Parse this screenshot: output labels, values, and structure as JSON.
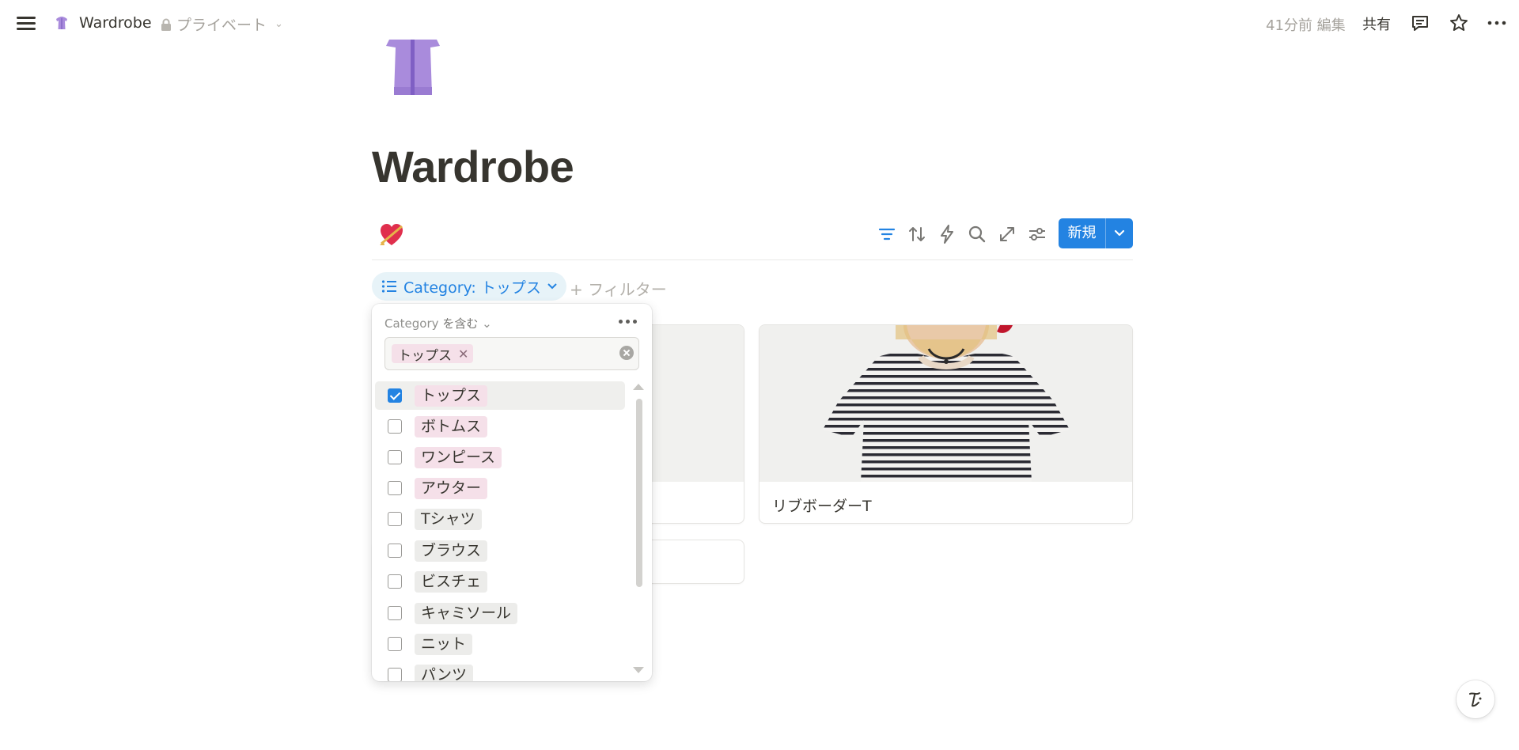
{
  "topbar": {
    "title": "Wardrobe",
    "privacy": "プライベート",
    "edited": "41分前 編集",
    "share": "共有",
    "icons": [
      "menu-icon",
      "lock-icon",
      "chevron-down-icon",
      "comment-icon",
      "star-icon",
      "more-icon"
    ]
  },
  "page": {
    "title": "Wardrobe",
    "icon": "dress-icon"
  },
  "database": {
    "view_icon": "heart-with-arrow-icon",
    "tools": [
      "filter-icon",
      "sort-icon",
      "automation-icon",
      "search-icon",
      "expand-icon",
      "settings-icon"
    ],
    "new_label": "新規",
    "filter_chip": "Category: トップス",
    "add_filter": "+ フィルター"
  },
  "cards": [
    {
      "title": "リブボーダーT"
    }
  ],
  "filter_popup": {
    "property": "Category",
    "operator": "を含む",
    "selected_tag": "トップス",
    "options": [
      {
        "label": "トップス",
        "checked": true,
        "color": "pink"
      },
      {
        "label": "ボトムス",
        "checked": false,
        "color": "pink"
      },
      {
        "label": "ワンピース",
        "checked": false,
        "color": "pink"
      },
      {
        "label": "アウター",
        "checked": false,
        "color": "pink"
      },
      {
        "label": "Tシャツ",
        "checked": false,
        "color": "gray"
      },
      {
        "label": "ブラウス",
        "checked": false,
        "color": "gray"
      },
      {
        "label": "ビスチェ",
        "checked": false,
        "color": "gray"
      },
      {
        "label": "キャミソール",
        "checked": false,
        "color": "gray"
      },
      {
        "label": "ニット",
        "checked": false,
        "color": "gray"
      },
      {
        "label": "パンツ",
        "checked": false,
        "color": "gray"
      }
    ]
  },
  "colors": {
    "accent": "#2383e2",
    "text": "#37352f",
    "pink_tag": "#f5e0e9",
    "gray_tag": "#ececea",
    "dress": "#a98bdc"
  }
}
